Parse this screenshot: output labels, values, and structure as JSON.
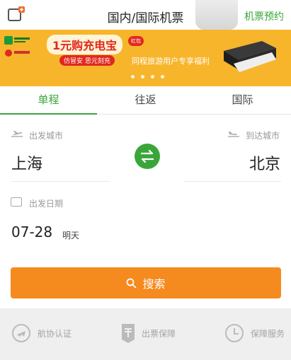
{
  "header": {
    "title": "国内/国际机票",
    "right_link": "机票预约",
    "left_icon": "add-window-icon"
  },
  "banner": {
    "promo": "1元购充电宝",
    "sub_badges": "仿冒安 思元刻充",
    "badge": "红包",
    "slogan": "同程旅游用户专享福利",
    "dot_count": 4
  },
  "tabs": [
    "单程",
    "往返",
    "国际"
  ],
  "form": {
    "departure_label": "出发城市",
    "departure_city": "上海",
    "arrival_label": "到达城市",
    "arrival_city": "北京",
    "date_label": "出发日期",
    "date_value": "07-28",
    "date_day": "明天",
    "search_label": "搜索"
  },
  "footer": {
    "features": [
      {
        "label": "航协认证",
        "icon": "airplane-certified-icon"
      },
      {
        "label": "出票保障",
        "icon": "ticket-guarantee-icon"
      },
      {
        "label": "保障服务",
        "icon": "clock-icon"
      }
    ]
  },
  "colors": {
    "accent": "#3aa63a",
    "search_button": "#f58a1e",
    "banner_bg": "#f7b52c",
    "footer_bg": "#efefef"
  }
}
